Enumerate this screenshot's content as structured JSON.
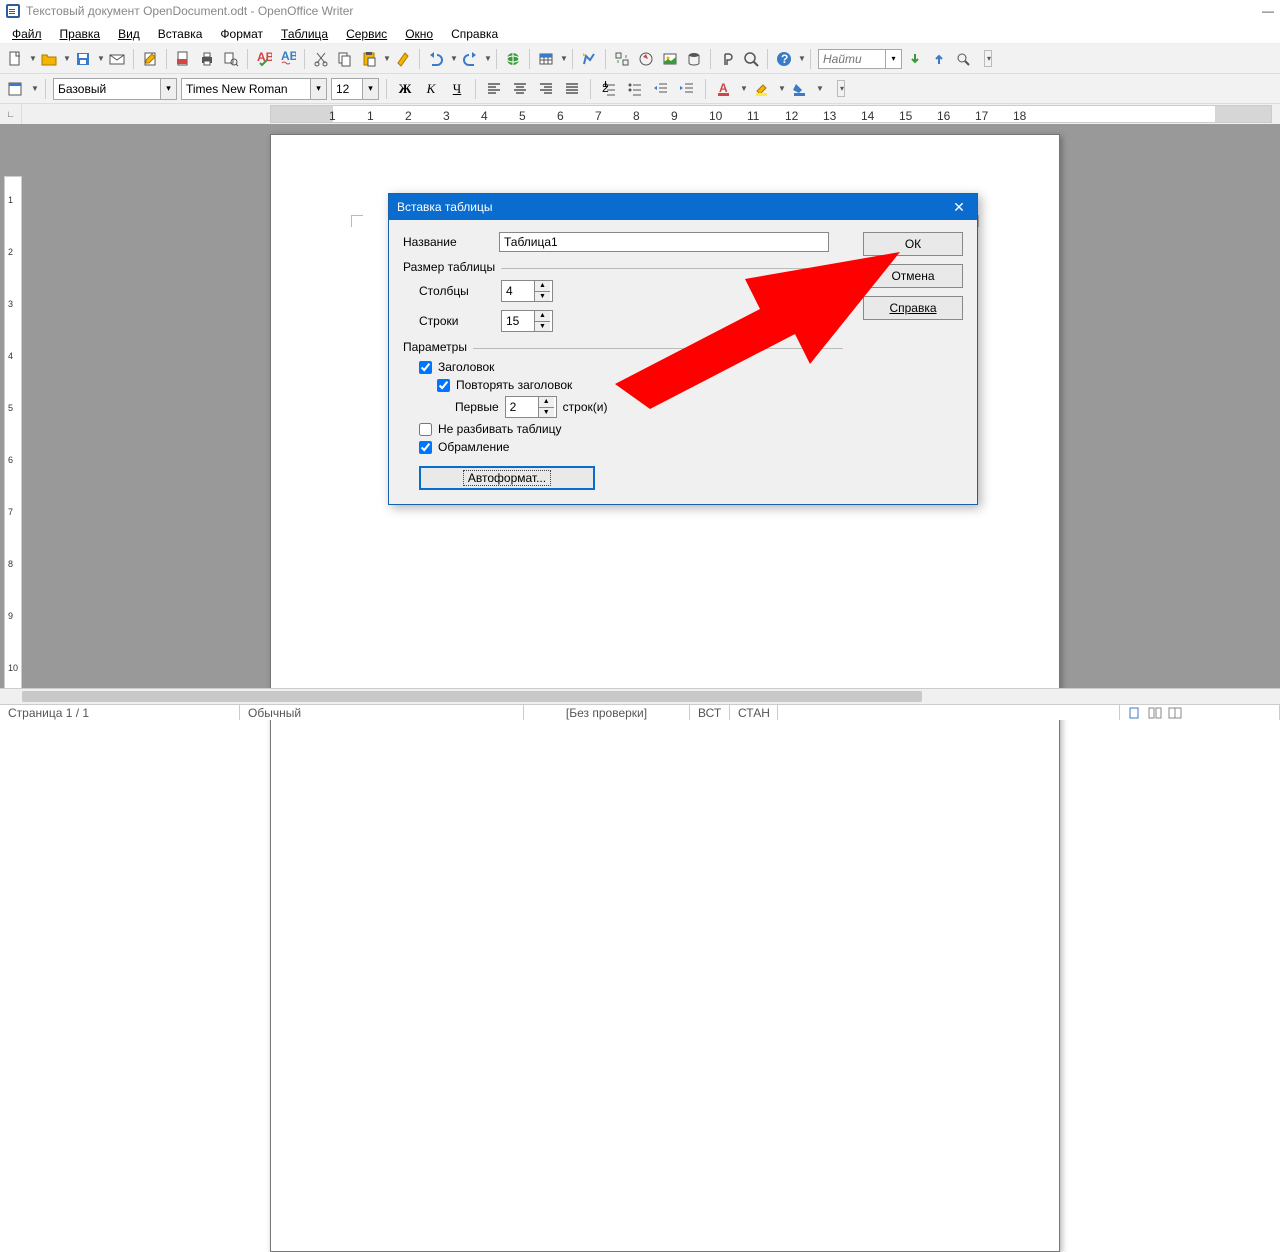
{
  "titlebar": {
    "text": "Текстовый документ OpenDocument.odt - OpenOffice Writer"
  },
  "menus": [
    "Файл",
    "Правка",
    "Вид",
    "Вставка",
    "Формат",
    "Таблица",
    "Сервис",
    "Окно",
    "Справка"
  ],
  "menu_mnemonic_idx": [
    0,
    0,
    0,
    2,
    1,
    0,
    0,
    0,
    2
  ],
  "searchbox": {
    "placeholder": "Найти"
  },
  "format": {
    "style": "Базовый",
    "font": "Times New Roman",
    "size": "12"
  },
  "ruler_numbers": [
    "1",
    "1",
    "2",
    "3",
    "4",
    "5",
    "6",
    "7",
    "8",
    "9",
    "10",
    "11",
    "12",
    "13",
    "14",
    "15",
    "16",
    "17",
    "18"
  ],
  "vruler_numbers": [
    "1",
    "2",
    "3",
    "4",
    "5",
    "6",
    "7",
    "8",
    "9",
    "10"
  ],
  "dialog": {
    "title": "Вставка таблицы",
    "name_label": "Название",
    "name_value": "Таблица1",
    "size_label": "Размер таблицы",
    "cols_label": "Столбцы",
    "cols_value": "4",
    "rows_label": "Строки",
    "rows_value": "15",
    "params_label": "Параметры",
    "chk_header": "Заголовок",
    "chk_repeat": "Повторять заголовок",
    "first_label": "Первые",
    "first_value": "2",
    "first_suffix": "строк(и)",
    "chk_nosplit": "Не разбивать таблицу",
    "chk_border": "Обрамление",
    "chk_header_checked": true,
    "chk_repeat_checked": true,
    "chk_nosplit_checked": false,
    "chk_border_checked": true,
    "btn_autofmt": "Автоформат...",
    "btn_ok": "ОК",
    "btn_cancel": "Отмена",
    "btn_help": "Справка"
  },
  "status": {
    "page": "Страница 1 / 1",
    "style": "Обычный",
    "lang": "[Без проверки]",
    "ins": "ВСТ",
    "std": "СТАН"
  }
}
